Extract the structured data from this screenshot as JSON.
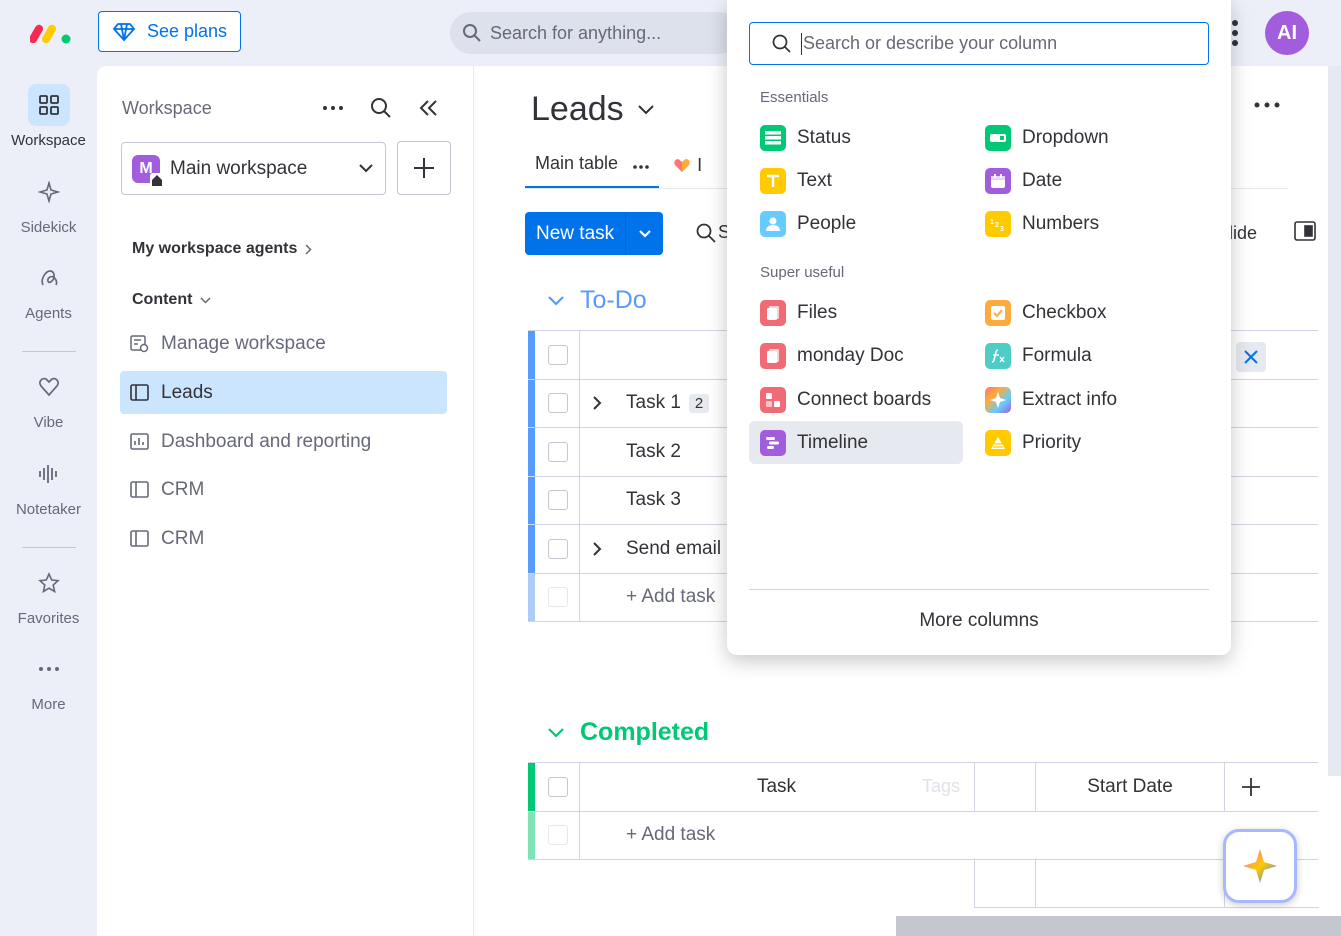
{
  "topbar": {
    "see_plans": "See plans",
    "search_placeholder": "Search for anything...",
    "avatar_initials": "AI"
  },
  "rail": {
    "items": [
      {
        "label": "Workspace",
        "icon": "grid-icon"
      },
      {
        "label": "Sidekick",
        "icon": "sparkle-icon"
      },
      {
        "label": "Agents",
        "icon": "agents-icon"
      },
      {
        "label": "Vibe",
        "icon": "heart-icon"
      },
      {
        "label": "Notetaker",
        "icon": "waveform-icon"
      },
      {
        "label": "Favorites",
        "icon": "star-icon"
      },
      {
        "label": "More",
        "icon": "dots-icon"
      }
    ]
  },
  "workspace": {
    "title": "Workspace",
    "selected": "Main workspace",
    "badge": "M",
    "agents_section": "My workspace agents",
    "content_section": "Content",
    "items": [
      {
        "label": "Manage workspace",
        "icon": "settings-icon"
      },
      {
        "label": "Leads",
        "icon": "board-icon"
      },
      {
        "label": "Dashboard and reporting",
        "icon": "dashboard-icon"
      },
      {
        "label": "CRM",
        "icon": "board-icon"
      },
      {
        "label": "CRM",
        "icon": "board-icon"
      }
    ]
  },
  "board": {
    "title": "Leads",
    "tab_main": "Main table",
    "tab_second": "I",
    "new_task": "New task",
    "search_hint": "S",
    "hide_label": "lide",
    "groups": {
      "todo": {
        "title": "To-Do",
        "color": "#579bfc",
        "tasks": [
          {
            "name": "Task 1",
            "subitems": "2"
          },
          {
            "name": "Task 2"
          },
          {
            "name": "Task 3"
          },
          {
            "name": "Send email"
          }
        ],
        "add_task": "+ Add task"
      },
      "completed": {
        "title": "Completed",
        "color": "#00c875",
        "col_task": "Task",
        "col_tags": "Tags",
        "col_start": "Start Date",
        "add_task": "+ Add task"
      }
    }
  },
  "popup": {
    "search_placeholder": "Search or describe your column",
    "essentials_label": "Essentials",
    "super_useful_label": "Super useful",
    "essentials": [
      {
        "label": "Status",
        "color": "#00c875",
        "icon": "status-icon"
      },
      {
        "label": "Dropdown",
        "color": "#00c875",
        "icon": "dropdown-icon"
      },
      {
        "label": "Text",
        "color": "#ffcb00",
        "icon": "text-icon"
      },
      {
        "label": "Date",
        "color": "#a25ddc",
        "icon": "calendar-icon"
      },
      {
        "label": "People",
        "color": "#66ccff",
        "icon": "person-icon"
      },
      {
        "label": "Numbers",
        "color": "#ffcb00",
        "icon": "numbers-icon"
      }
    ],
    "super_useful": [
      {
        "label": "Files",
        "color": "#f06b76",
        "icon": "file-icon"
      },
      {
        "label": "Checkbox",
        "color": "#fdab3d",
        "icon": "checkbox-icon"
      },
      {
        "label": "monday Doc",
        "color": "#f06b76",
        "icon": "doc-icon"
      },
      {
        "label": "Formula",
        "color": "#4eccc6",
        "icon": "formula-icon"
      },
      {
        "label": "Connect boards",
        "color": "#f06b76",
        "icon": "connect-icon"
      },
      {
        "label": "Extract info",
        "color": "#ff7575",
        "icon": "ai-sparkle-icon"
      },
      {
        "label": "Timeline",
        "color": "#a25ddc",
        "icon": "timeline-icon"
      },
      {
        "label": "Priority",
        "color": "#ffcb00",
        "icon": "priority-icon"
      }
    ],
    "more_columns": "More columns"
  }
}
